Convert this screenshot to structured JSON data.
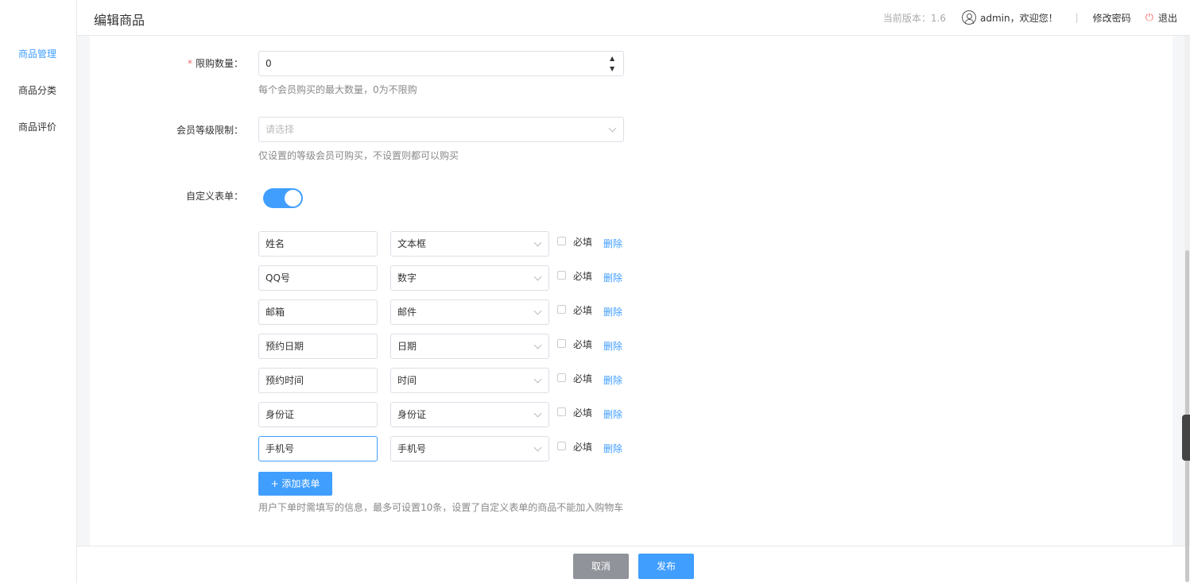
{
  "sidebar": {
    "items": [
      {
        "label": "商品管理",
        "active": true
      },
      {
        "label": "商品分类",
        "active": false
      },
      {
        "label": "商品评价",
        "active": false
      }
    ]
  },
  "header": {
    "title": "编辑商品",
    "version": "当前版本：1.6",
    "welcome": "admin，欢迎您！",
    "separator": "|",
    "change_password": "修改密码",
    "logout": "退出",
    "icons": [
      "user-icon",
      "power-icon"
    ]
  },
  "form": {
    "limit": {
      "label": "限购数量：",
      "required_mark": "*",
      "value": "0",
      "hint": "每个会员购买的最大数量，0为不限购"
    },
    "member_level": {
      "label": "会员等级限制：",
      "placeholder": "请选择",
      "hint": "仅设置的等级会员可购买，不设置则都可以购买"
    },
    "custom_form": {
      "label": "自定义表单：",
      "enabled": true,
      "required_label": "必填",
      "delete_label": "删除",
      "rows": [
        {
          "name": "姓名",
          "type": "文本框"
        },
        {
          "name": "QQ号",
          "type": "数字"
        },
        {
          "name": "邮箱",
          "type": "邮件"
        },
        {
          "name": "预约日期",
          "type": "日期"
        },
        {
          "name": "预约时间",
          "type": "时间"
        },
        {
          "name": "身份证",
          "type": "身份证"
        },
        {
          "name": "手机号",
          "type": "手机号"
        }
      ],
      "add_button": "+ 添加表单",
      "hint": "用户下单时需填写的信息，最多可设置10条，设置了自定义表单的商品不能加入购物车"
    }
  },
  "footer": {
    "cancel": "取消",
    "publish": "发布"
  },
  "colors": {
    "accent": "#409eff",
    "cancel_bg": "#909399",
    "required": "#f56c6c"
  }
}
